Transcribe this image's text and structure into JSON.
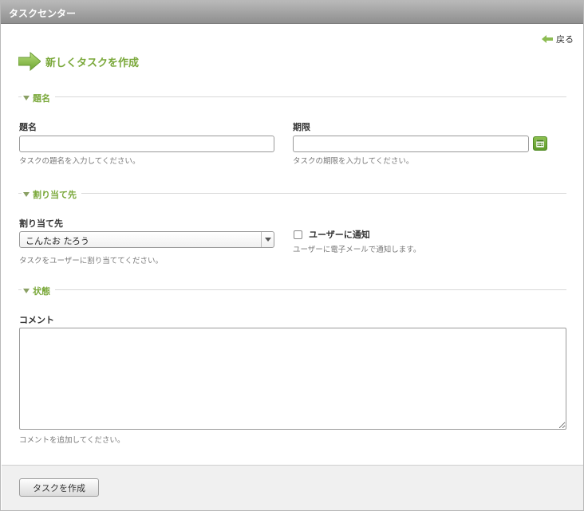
{
  "window": {
    "title": "タスクセンター"
  },
  "nav": {
    "back_label": "戻る"
  },
  "page": {
    "heading": "新しくタスクを作成"
  },
  "sections": {
    "title": "題名",
    "assign": "割り当て先",
    "status": "状態"
  },
  "fields": {
    "title": {
      "label": "題名",
      "value": "",
      "hint": "タスクの題名を入力してください。"
    },
    "due": {
      "label": "期限",
      "value": "",
      "hint": "タスクの期限を入力してください。"
    },
    "assignee": {
      "label": "割り当て先",
      "selected": "こんたお たろう",
      "hint": "タスクをユーザーに割り当ててください。"
    },
    "notify": {
      "label": "ユーザーに通知",
      "checked": false,
      "hint": "ユーザーに電子メールで通知します。"
    },
    "comment": {
      "label": "コメント",
      "value": "",
      "hint": "コメントを追加してください。"
    }
  },
  "actions": {
    "submit_label": "タスクを作成"
  },
  "colors": {
    "accent": "#7aa83a",
    "titlebar": "#a0a0a0"
  },
  "icons": {
    "back": "back-arrow-icon",
    "heading": "arrow-right-icon",
    "calendar": "calendar-icon",
    "section": "triangle-down-icon"
  }
}
